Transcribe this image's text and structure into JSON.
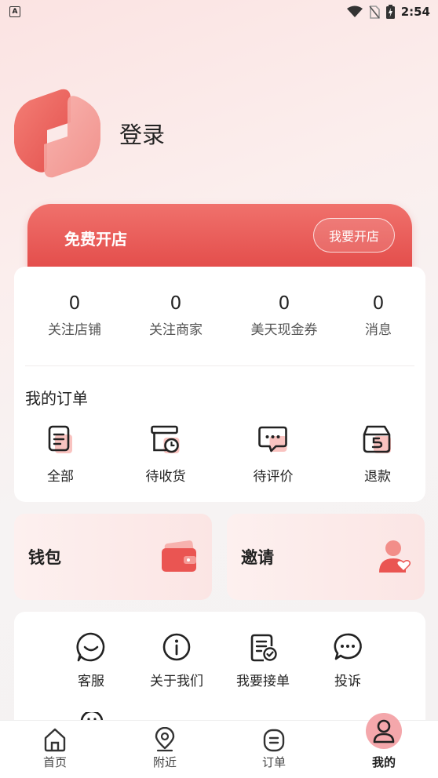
{
  "status_bar": {
    "time": "2:54",
    "badge": "A"
  },
  "profile": {
    "login_label": "登录"
  },
  "shop_banner": {
    "title": "免费开店",
    "button_label": "我要开店"
  },
  "stats": [
    {
      "value": "0",
      "label": "关注店铺"
    },
    {
      "value": "0",
      "label": "关注商家"
    },
    {
      "value": "0",
      "label": "美天现金券"
    },
    {
      "value": "0",
      "label": "消息"
    }
  ],
  "orders": {
    "title": "我的订单",
    "items": [
      {
        "label": "全部",
        "icon": "clipboard-icon"
      },
      {
        "label": "待收货",
        "icon": "box-clock-icon"
      },
      {
        "label": "待评价",
        "icon": "chat-dots-icon"
      },
      {
        "label": "退款",
        "icon": "refund-box-icon"
      }
    ]
  },
  "wallet": {
    "title": "钱包",
    "icon": "wallet-icon"
  },
  "invite": {
    "title": "邀请",
    "icon": "user-heart-icon"
  },
  "tools": [
    {
      "label": "客服",
      "icon": "customer-service-icon"
    },
    {
      "label": "关于我们",
      "icon": "info-icon"
    },
    {
      "label": "我要接单",
      "icon": "document-check-icon"
    },
    {
      "label": "投诉",
      "icon": "complaint-icon"
    }
  ],
  "tabbar": [
    {
      "label": "首页",
      "icon": "home-icon"
    },
    {
      "label": "附近",
      "icon": "location-icon"
    },
    {
      "label": "订单",
      "icon": "order-icon"
    },
    {
      "label": "我的",
      "icon": "user-icon",
      "active": true
    }
  ],
  "colors": {
    "accent": "#e24a48",
    "accent_light": "#f0716c",
    "active_tab_bg": "#f4a7ab"
  }
}
